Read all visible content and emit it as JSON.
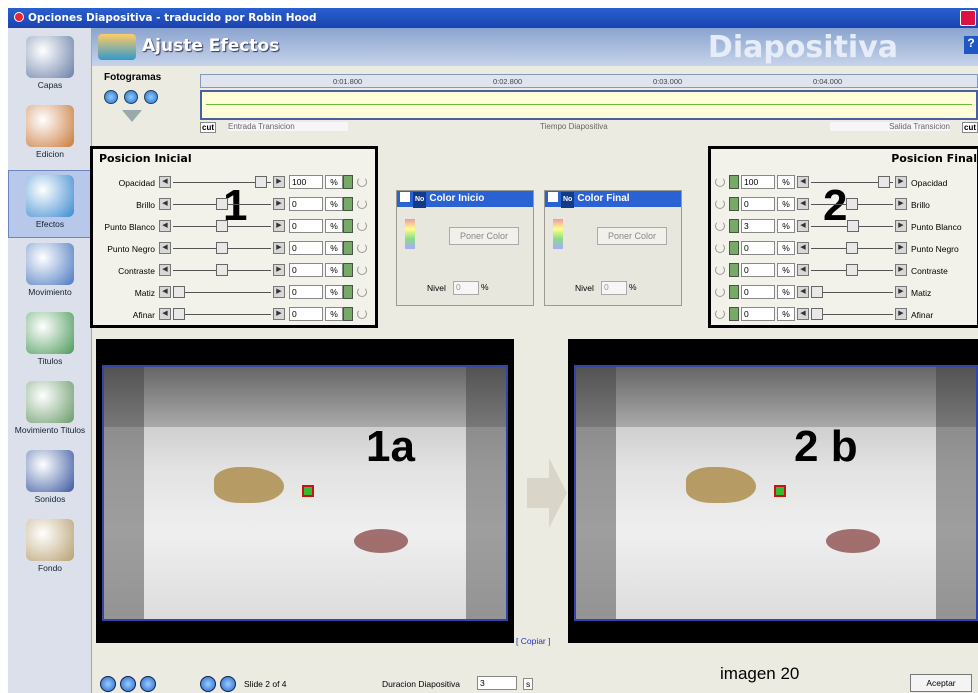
{
  "window": {
    "title": "Opciones Diapositiva - traducido por Robin Hood"
  },
  "banner": {
    "title": "Ajuste Efectos",
    "section": "Diapositiva",
    "help": "?"
  },
  "sidebar": {
    "items": [
      {
        "label": "Capas",
        "color": "#6a7fa8"
      },
      {
        "label": "Edicion",
        "color": "#c97a3a"
      },
      {
        "label": "Efectos",
        "color": "#3a8ad0"
      },
      {
        "label": "Movimiento",
        "color": "#4a79c0"
      },
      {
        "label": "Titulos",
        "color": "#4a9a58"
      },
      {
        "label": "Movimiento Titulos",
        "color": "#6a9a6a"
      },
      {
        "label": "Sonidos",
        "color": "#3a58a0"
      },
      {
        "label": "Fondo",
        "color": "#b8a070"
      }
    ],
    "active": "Efectos"
  },
  "timeline": {
    "label": "Fotogramas",
    "ticks": [
      "0:01.800",
      "0:02.800",
      "0:03.000",
      "0:04.000"
    ],
    "cut": "cut",
    "entrada": "Entrada Transicion",
    "tiempo": "Tiempo Diapositiva",
    "salida": "Salida Transicion"
  },
  "inicial": {
    "title": "Posicion Inicial",
    "annotation": "1",
    "rows": [
      {
        "label": "Opacidad",
        "value": "100",
        "pct": "%",
        "level": 0.95
      },
      {
        "label": "Brillo",
        "value": "0",
        "pct": "%",
        "level": 0.5
      },
      {
        "label": "Punto Blanco",
        "value": "0",
        "pct": "%",
        "level": 0.5
      },
      {
        "label": "Punto Negro",
        "value": "0",
        "pct": "%",
        "level": 0.5
      },
      {
        "label": "Contraste",
        "value": "0",
        "pct": "%",
        "level": 0.5
      },
      {
        "label": "Matiz",
        "value": "0",
        "pct": "%",
        "level": 0.0
      },
      {
        "label": "Afinar",
        "value": "0",
        "pct": "%",
        "level": 0.0
      }
    ]
  },
  "final": {
    "title": "Posicion Final",
    "annotation": "2",
    "rows": [
      {
        "label": "Opacidad",
        "value": "100",
        "pct": "%",
        "level": 0.95
      },
      {
        "label": "Brillo",
        "value": "0",
        "pct": "%",
        "level": 0.5
      },
      {
        "label": "Punto Blanco",
        "value": "3",
        "pct": "%",
        "level": 0.52
      },
      {
        "label": "Punto Negro",
        "value": "0",
        "pct": "%",
        "level": 0.5
      },
      {
        "label": "Contraste",
        "value": "0",
        "pct": "%",
        "level": 0.5
      },
      {
        "label": "Matiz",
        "value": "0",
        "pct": "%",
        "level": 0.0
      },
      {
        "label": "Afinar",
        "value": "0",
        "pct": "%",
        "level": 0.0
      }
    ]
  },
  "color_inicio": {
    "title": "Color Inicio",
    "no": "No",
    "button": "Poner Color",
    "nivel": "Nivel",
    "nivel_value": "0",
    "pct": "%"
  },
  "color_final": {
    "title": "Color Final",
    "no": "No",
    "button": "Poner Color",
    "nivel": "Nivel",
    "nivel_value": "0",
    "pct": "%"
  },
  "preview": {
    "left_label": "1a",
    "right_label": "2 b",
    "copiar": "[ Copiar ]"
  },
  "footer": {
    "slide": "Slide 2 of 4",
    "duracion_label": "Duracion Diapositiva",
    "duracion_value": "3",
    "unit": "s",
    "imagen": "imagen 20",
    "aceptar": "Aceptar"
  }
}
